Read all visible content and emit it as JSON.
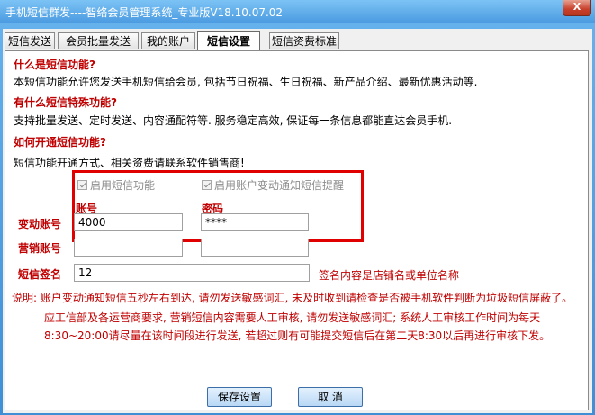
{
  "window": {
    "title": "手机短信群发----智络会员管理系统_专业版V18.10.07.02",
    "close_label": "X"
  },
  "tabs": [
    {
      "label": "短信发送"
    },
    {
      "label": "会员批量发送"
    },
    {
      "label": "我的账户"
    },
    {
      "label": "短信设置",
      "active": true
    },
    {
      "label": "短信资费标准"
    }
  ],
  "info": {
    "q1": "什么是短信功能?",
    "a1": "本短信功能允许您发送手机短信给会员, 包括节日祝福、生日祝福、新产品介绍、最新优惠活动等.",
    "q2": "有什么短信特殊功能?",
    "a2": "支持批量发送、定时发送、内容通配符等. 服务稳定高效, 保证每一条信息都能直达会员手机.",
    "q3": "如何开通短信功能?",
    "a3": "短信功能开通方式、相关资费请联系软件销售商!"
  },
  "settings": {
    "enable_sms": {
      "label": "启用短信功能",
      "checked": true
    },
    "enable_notify": {
      "label": "启用账户变动通知短信提醒",
      "checked": true
    },
    "col_account": "账号",
    "col_password": "密码",
    "row_change_account": "变动账号",
    "row_marketing_account": "营销账号",
    "row_signature": "短信签名",
    "change_account_value": "4000",
    "change_password_value": "****",
    "marketing_account_value": "",
    "marketing_password_value": "",
    "signature_value": "12",
    "signature_hint": "签名内容是店铺名或单位名称"
  },
  "note": {
    "line1": "说明: 账户变动通知短信五秒左右到达, 请勿发送敏感词汇, 未及时收到请检查是否被手机软件判断为垃圾短信屏蔽了。",
    "line2": "应工信部及各运营商要求, 营销短信内容需要人工审核, 请勿发送敏感词汇; 系统人工审核工作时间为每天",
    "line3": "8:30~20:00请尽量在该时间段进行发送, 若超过则有可能提交短信后在第二天8:30以后再进行审核下发。"
  },
  "buttons": {
    "save": "保存设置",
    "cancel": "取 消"
  },
  "colors": {
    "accent_red": "#c00000",
    "title_blue": "#4a9ae0"
  }
}
